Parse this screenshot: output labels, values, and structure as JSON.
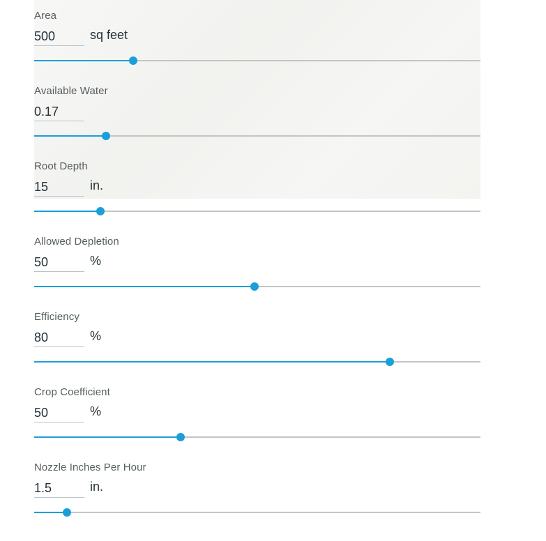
{
  "fields": [
    {
      "label": "Area",
      "value": "500",
      "unit": "sq feet",
      "fraction": 0.222
    },
    {
      "label": "Available Water",
      "value": "0.17",
      "unit": "",
      "fraction": 0.161
    },
    {
      "label": "Root Depth",
      "value": "15",
      "unit": "in.",
      "fraction": 0.148
    },
    {
      "label": "Allowed Depletion",
      "value": "50",
      "unit": "%",
      "fraction": 0.494
    },
    {
      "label": "Efficiency",
      "value": "80",
      "unit": "%",
      "fraction": 0.797
    },
    {
      "label": "Crop Coefficient",
      "value": "50",
      "unit": "%",
      "fraction": 0.328
    },
    {
      "label": "Nozzle Inches Per Hour",
      "value": "1.5",
      "unit": "in.",
      "fraction": 0.073
    }
  ],
  "colors": {
    "accent": "#1a9fd8",
    "track": "#c4c4c4",
    "label": "#555d60",
    "value": "#23323a"
  }
}
